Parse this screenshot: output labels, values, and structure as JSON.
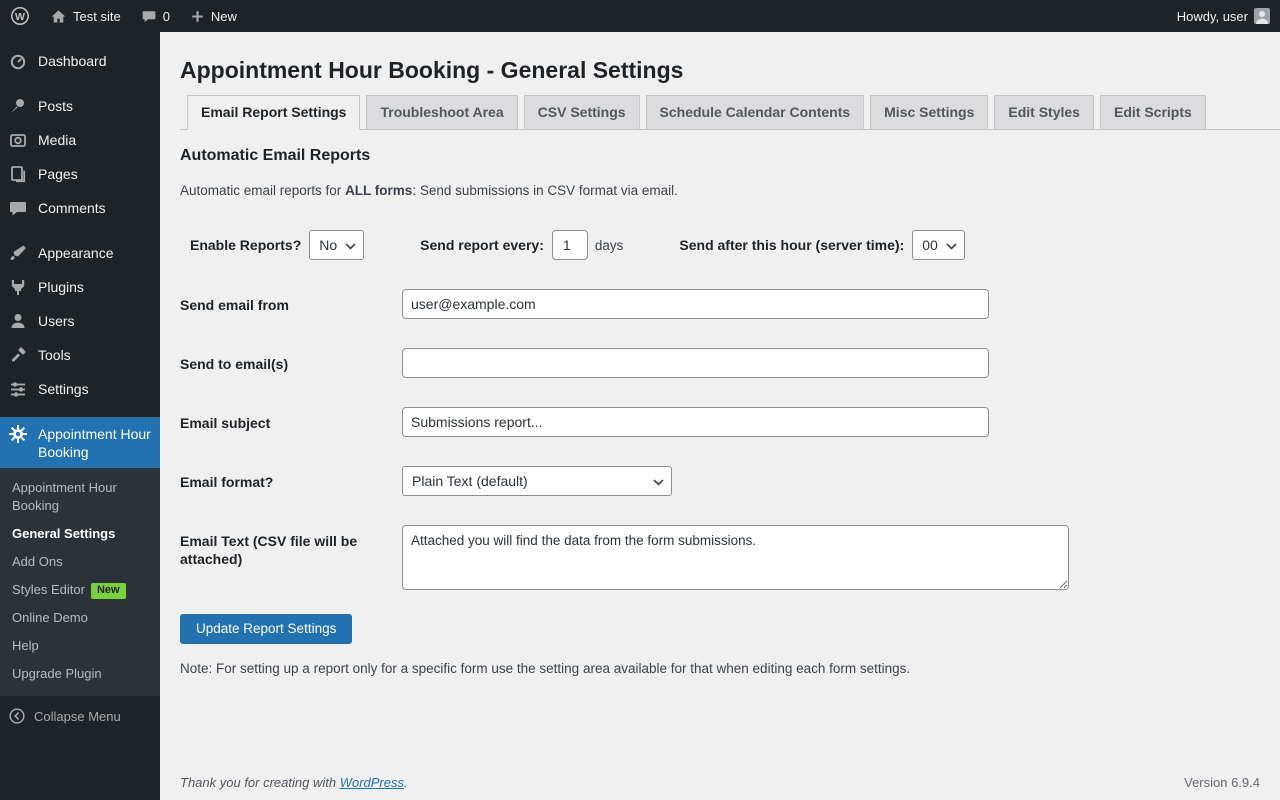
{
  "colors": {
    "accent_blue": "#2271b1",
    "admin_dark": "#1d2327",
    "submenu_dark": "#2c3338",
    "page_bg": "#f0f0f1",
    "badge_green": "#7ad03a"
  },
  "icons": {
    "wordpress-logo-icon": "W in circle",
    "home-icon": "house",
    "comments-bubble-icon": "speech bubble",
    "plus-icon": "plus",
    "avatar": "person silhouette",
    "dashboard-icon": "gauge",
    "posts-icon": "pushpin",
    "media-icon": "camera",
    "pages-icon": "stacked pages",
    "comments-icon": "speech bubble",
    "appearance-icon": "paint brush",
    "plugins-icon": "power plug",
    "users-icon": "person",
    "tools-icon": "hammer",
    "settings-icon": "sliders",
    "gear-icon": "gear",
    "collapse-icon": "left arrow in circle",
    "chevron-down-icon": "chevron down"
  },
  "admin_bar": {
    "site_name": "Test site",
    "comments_count": "0",
    "new_label": "New",
    "howdy": "Howdy, user"
  },
  "sidebar": {
    "items": [
      {
        "label": "Dashboard",
        "icon": "dashboard-icon"
      },
      {
        "label": "Posts",
        "icon": "posts-icon"
      },
      {
        "label": "Media",
        "icon": "media-icon"
      },
      {
        "label": "Pages",
        "icon": "pages-icon"
      },
      {
        "label": "Comments",
        "icon": "comments-icon"
      },
      {
        "label": "Appearance",
        "icon": "appearance-icon"
      },
      {
        "label": "Plugins",
        "icon": "plugins-icon"
      },
      {
        "label": "Users",
        "icon": "users-icon"
      },
      {
        "label": "Tools",
        "icon": "tools-icon"
      },
      {
        "label": "Settings",
        "icon": "settings-icon"
      }
    ],
    "plugin_menu": {
      "label": "Appointment Hour Booking",
      "icon": "gear-icon"
    },
    "submenu": [
      {
        "label": "Appointment Hour Booking"
      },
      {
        "label": "General Settings",
        "current": true
      },
      {
        "label": "Add Ons"
      },
      {
        "label": "Styles Editor",
        "badge": "New"
      },
      {
        "label": "Online Demo"
      },
      {
        "label": "Help"
      },
      {
        "label": "Upgrade Plugin"
      }
    ],
    "collapse_label": "Collapse Menu"
  },
  "main": {
    "page_title": "Appointment Hour Booking - General Settings",
    "tabs": [
      "Email Report Settings",
      "Troubleshoot Area",
      "CSV Settings",
      "Schedule Calendar Contents",
      "Misc Settings",
      "Edit Styles",
      "Edit Scripts"
    ],
    "active_tab": "Email Report Settings",
    "section_title": "Automatic Email Reports",
    "intro": {
      "prefix": "Automatic email reports for ",
      "bold": "ALL forms",
      "suffix": ": Send submissions in CSV format via email."
    },
    "form": {
      "enable_label": "Enable Reports?",
      "enable_value": "No",
      "every_label": "Send report every:",
      "every_value": "1",
      "every_unit": "days",
      "hour_label": "Send after this hour (server time):",
      "hour_value": "00",
      "from_label": "Send email from",
      "from_value": "user@example.com",
      "to_label": "Send to email(s)",
      "to_value": "",
      "subject_label": "Email subject",
      "subject_value": "Submissions report...",
      "format_label": "Email format?",
      "format_value": "Plain Text (default)",
      "body_label": "Email Text (CSV file will be attached)",
      "body_value": "Attached you will find the data from the form submissions.",
      "submit_label": "Update Report Settings"
    },
    "note": "Note: For setting up a report only for a specific form use the setting area available for that when editing each form settings."
  },
  "footer": {
    "thanks_prefix": "Thank you for creating with ",
    "thanks_link": "WordPress",
    "thanks_suffix": ".",
    "version": "Version 6.9.4"
  }
}
